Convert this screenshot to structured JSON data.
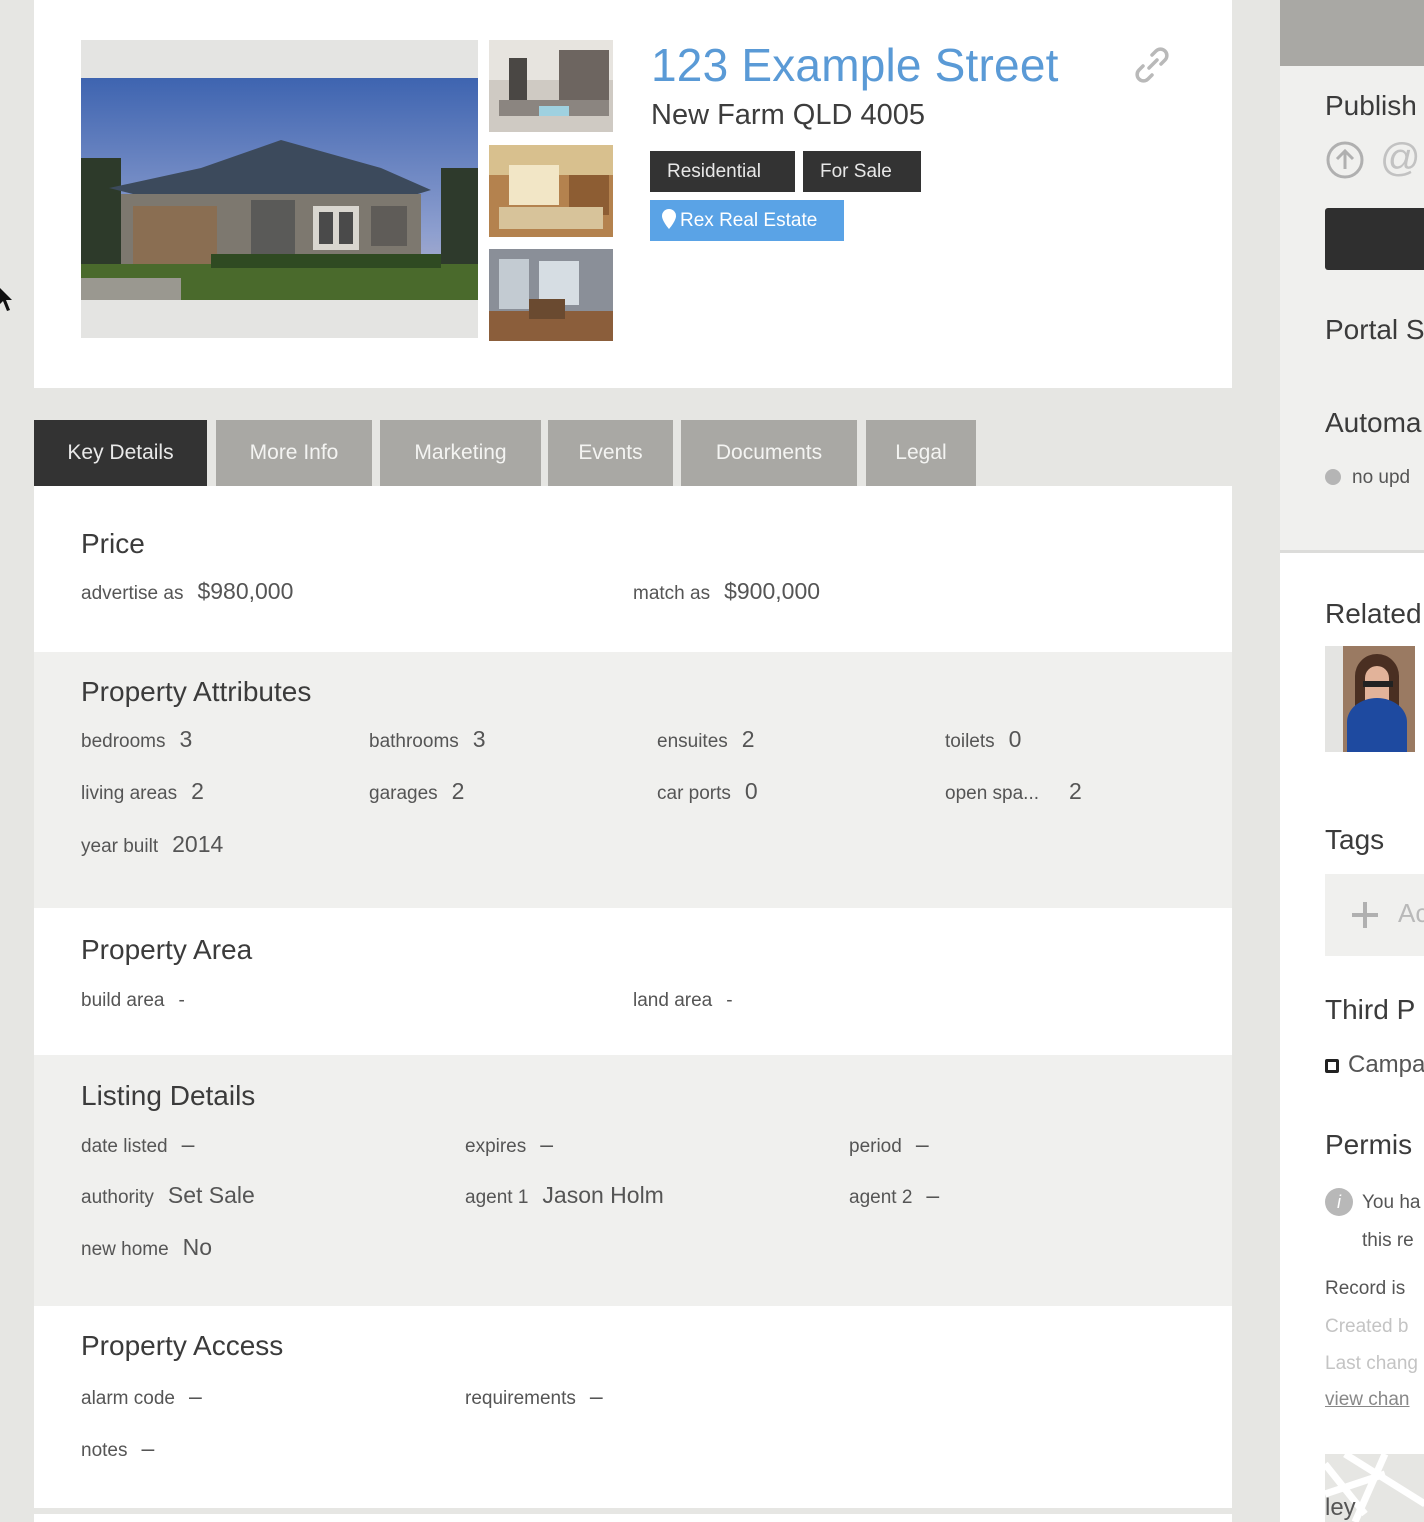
{
  "listing": {
    "address": "123 Example Street",
    "suburb_line": "New Farm QLD 4005",
    "tags": [
      "Residential",
      "For Sale"
    ],
    "agency": "Rex Real Estate"
  },
  "tabs": [
    "Key Details",
    "More Info",
    "Marketing",
    "Events",
    "Documents",
    "Legal"
  ],
  "price": {
    "title": "Price",
    "advertise_label": "advertise as",
    "advertise_value": "$980,000",
    "match_label": "match as",
    "match_value": "$900,000"
  },
  "attributes": {
    "title": "Property Attributes",
    "items": [
      {
        "label": "bedrooms",
        "value": "3"
      },
      {
        "label": "bathrooms",
        "value": "3"
      },
      {
        "label": "ensuites",
        "value": "2"
      },
      {
        "label": "toilets",
        "value": "0"
      },
      {
        "label": "living areas",
        "value": "2"
      },
      {
        "label": "garages",
        "value": "2"
      },
      {
        "label": "car ports",
        "value": "0"
      },
      {
        "label": "open spa...",
        "value": "2"
      },
      {
        "label": "year built",
        "value": "2014"
      }
    ]
  },
  "area": {
    "title": "Property Area",
    "build_label": "build area",
    "build_value": "-",
    "land_label": "land area",
    "land_value": "-"
  },
  "listing_details": {
    "title": "Listing Details",
    "items": [
      {
        "label": "date listed",
        "value": "–"
      },
      {
        "label": "expires",
        "value": "–"
      },
      {
        "label": "period",
        "value": "–"
      },
      {
        "label": "authority",
        "value": "Set Sale"
      },
      {
        "label": "agent 1",
        "value": "Jason Holm"
      },
      {
        "label": "agent 2",
        "value": "–"
      },
      {
        "label": "new home",
        "value": "No"
      }
    ]
  },
  "access": {
    "title": "Property Access",
    "alarm_label": "alarm code",
    "alarm_value": "–",
    "req_label": "requirements",
    "req_value": "–",
    "notes_label": "notes",
    "notes_value": "–"
  },
  "sidebar": {
    "publish": "Publish",
    "portal": "Portal S",
    "automa": "Automa",
    "no_upd": "no upd",
    "related": "Related",
    "tags": "Tags",
    "add": "Ac",
    "third": "Third P",
    "campaign": "Campa",
    "permis": "Permis",
    "you_ha": "You ha",
    "this_re": "this re",
    "record_is": "Record is",
    "created": "Created b",
    "last_chan": "Last chang",
    "view_chan": "view chan",
    "map_label": "ley"
  },
  "colors": {
    "accent_blue": "#5a9ad6",
    "badge_blue": "#5aa3e6",
    "tag_dark": "#333333",
    "tab_inactive": "#a9a8a4"
  }
}
